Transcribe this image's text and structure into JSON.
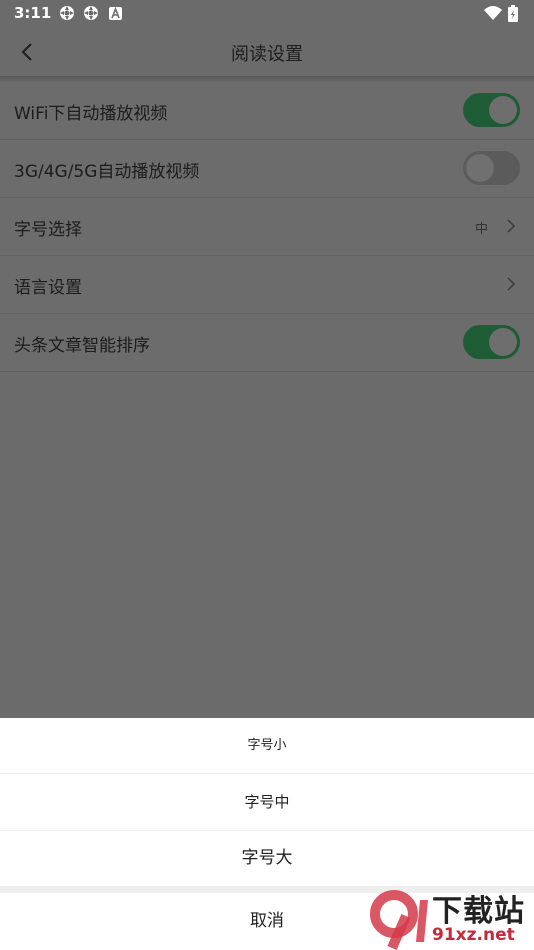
{
  "status_bar": {
    "time": "3:11",
    "icons": [
      "sync-icon",
      "sync-icon",
      "font-icon",
      "wifi-icon",
      "battery-icon"
    ]
  },
  "header": {
    "title": "阅读设置",
    "back_icon": "chevron-left-icon"
  },
  "settings": {
    "rows": [
      {
        "label": "WiFi下自动播放视频",
        "type": "toggle",
        "on": true
      },
      {
        "label": "3G/4G/5G自动播放视频",
        "type": "toggle",
        "on": false
      },
      {
        "label": "字号选择",
        "type": "select",
        "value": "中"
      },
      {
        "label": "语言设置",
        "type": "link"
      },
      {
        "label": "头条文章智能排序",
        "type": "toggle",
        "on": true
      }
    ]
  },
  "font_sheet": {
    "options": [
      "字号小",
      "字号中",
      "字号大"
    ],
    "cancel": "取消"
  },
  "watermark": {
    "logo": "9f",
    "title": "下载站",
    "domain": "91xz.net"
  },
  "colors": {
    "toggle_on": "#1d5c35",
    "overlay": "#6b6b6b",
    "watermark_red": "#c62a3a"
  }
}
